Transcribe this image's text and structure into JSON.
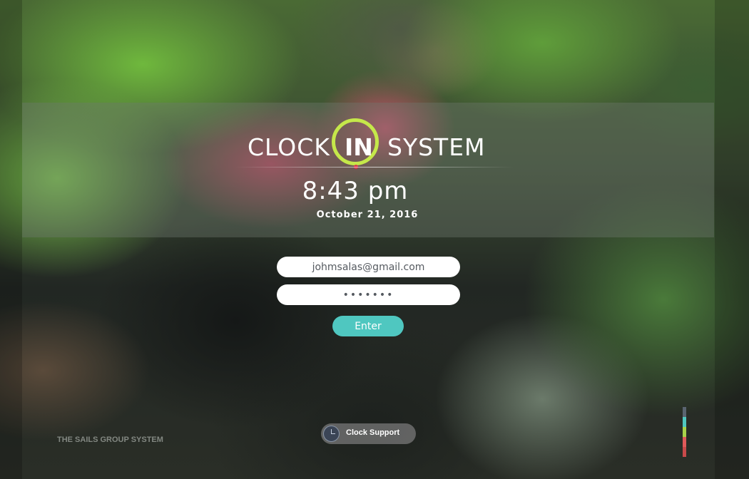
{
  "app": {
    "logo_left": "CLOCK",
    "logo_center": "IN",
    "logo_right": "SYSTEM",
    "ring_color": "#c5e84a"
  },
  "clock": {
    "time": "8:43 pm",
    "date": "October 21, 2016"
  },
  "login": {
    "email_value": "johmsalas@gmail.com",
    "password_value": "•••••••",
    "enter_label": "Enter",
    "enter_color": "#4fc7c0"
  },
  "footer": {
    "brand": "THE SAILS GROUP SYSTEM",
    "support_label": "Clock Support",
    "support_icon": "clock-icon",
    "color_bar": [
      "#5a6470",
      "#4fc7c0",
      "#a8d24a",
      "#e05a5a",
      "#c84a4a"
    ]
  }
}
